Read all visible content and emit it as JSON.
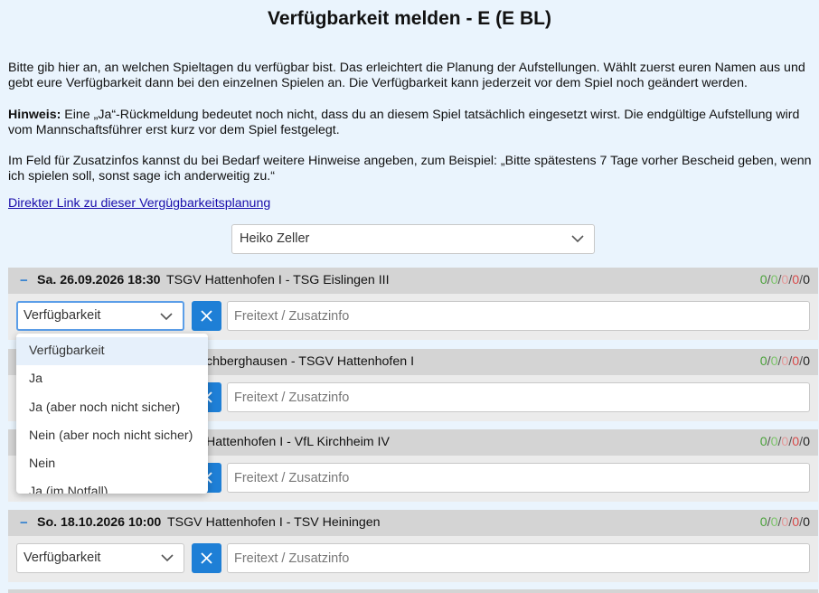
{
  "page": {
    "title": "Verfügbarkeit melden - E (E BL)",
    "intro": "Bitte gib hier an, an welchen Spieltagen du verfügbar bist. Das erleichtert die Planung der Aufstellungen. Wählt zuerst euren Namen aus und gebt eure Verfügbarkeit dann bei den einzelnen Spielen an. Die Verfügbarkeit kann jederzeit vor dem Spiel noch geändert werden.",
    "hint_label": "Hinweis:",
    "hint_text": " Eine „Ja“-Rückmeldung bedeutet noch nicht, dass du an diesem Spiel tatsächlich eingesetzt wirst. Die endgültige Aufstellung wird vom Mannschaftsführer erst kurz vor dem Spiel festgelegt.",
    "extra_info": "Im Feld für Zusatzinfos kannst du bei Bedarf weitere Hinweise angeben, zum Beispiel: „Bitte spätestens 7 Tage vorher Bescheid geben, wenn ich spielen soll, sonst sage ich anderweitig zu.“",
    "direct_link": "Direkter Link zu dieser Vergügbarkeitsplanung"
  },
  "name_select": {
    "value": "Heiko Zeller"
  },
  "colors": {
    "accent": "#1e7fd6",
    "yes": "#4aa23a",
    "no": "#d94a4a"
  },
  "matches": [
    {
      "date": "Sa. 26.09.2026 18:30",
      "teams": "TSGV Hattenhofen I - TSG Eislingen III",
      "counts": [
        "0",
        "0",
        "0",
        "0",
        "0"
      ],
      "availability": "Verfügbarkeit",
      "placeholder": "Freitext / Zusatzinfo"
    },
    {
      "date": "",
      "teams": "chberghausen - TSGV Hattenhofen I",
      "counts": [
        "0",
        "0",
        "0",
        "0",
        "0"
      ],
      "availability": "",
      "placeholder": "Freitext / Zusatzinfo"
    },
    {
      "date": "",
      "teams": "Hattenhofen I - VfL Kirchheim IV",
      "counts": [
        "0",
        "0",
        "0",
        "0",
        "0"
      ],
      "availability": "",
      "placeholder": "Freitext / Zusatzinfo"
    },
    {
      "date": "So. 18.10.2026 10:00",
      "teams": "TSGV Hattenhofen I - TSV Heiningen",
      "counts": [
        "0",
        "0",
        "0",
        "0",
        "0"
      ],
      "availability": "Verfügbarkeit",
      "placeholder": "Freitext / Zusatzinfo"
    }
  ],
  "dropdown": {
    "options": [
      "Verfügbarkeit",
      "Ja",
      "Ja (aber noch nicht sicher)",
      "Nein (aber noch nicht sicher)",
      "Nein",
      "Ja (im Notfall)"
    ]
  },
  "icons": {
    "collapse": "minus-icon",
    "clear": "close-icon",
    "select": "chevron-down-icon"
  }
}
